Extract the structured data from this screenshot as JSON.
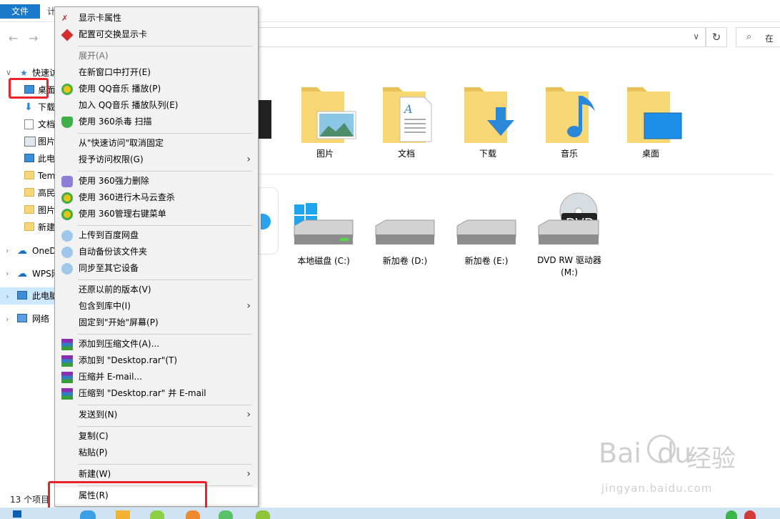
{
  "ribbon": {
    "file_tab": "文件",
    "tab2": "计"
  },
  "search": {
    "placeholder": "在"
  },
  "sidebar": {
    "items": [
      {
        "label": "快速访"
      },
      {
        "label": "桌面"
      },
      {
        "label": "下载"
      },
      {
        "label": "文档"
      },
      {
        "label": "图片"
      },
      {
        "label": "此电"
      },
      {
        "label": "Tem"
      },
      {
        "label": "高民"
      },
      {
        "label": "图片"
      },
      {
        "label": "新建"
      },
      {
        "label": "OneD"
      },
      {
        "label": "WPS网"
      },
      {
        "label": "此电脑"
      },
      {
        "label": "网络"
      }
    ]
  },
  "status": {
    "count": "13 个项目"
  },
  "folders": [
    {
      "label": "图片"
    },
    {
      "label": "文档"
    },
    {
      "label": "下载"
    },
    {
      "label": "音乐"
    },
    {
      "label": "桌面"
    }
  ],
  "drives": [
    {
      "label": "本地磁盘 (C:)"
    },
    {
      "label": "新加卷 (D:)"
    },
    {
      "label": "新加卷 (E:)"
    },
    {
      "label": "DVD RW 驱动器 (M:)",
      "badge": "DVD"
    }
  ],
  "menu": {
    "items": [
      {
        "label": "显示卡属性",
        "icon": "display-card-icon"
      },
      {
        "label": "配置可交换显示卡",
        "icon": "switchable-graphics-icon"
      },
      {
        "label": "展开(A)",
        "disabled": true
      },
      {
        "label": "在新窗口中打开(E)"
      },
      {
        "label": "使用 QQ音乐 播放(P)",
        "icon": "qq-music-icon"
      },
      {
        "label": "加入 QQ音乐 播放队列(E)"
      },
      {
        "label": "使用 360杀毒 扫描",
        "icon": "360-antivirus-icon"
      },
      {
        "label": "从\"快速访问\"取消固定"
      },
      {
        "label": "授予访问权限(G)",
        "submenu": true
      },
      {
        "label": "使用 360强力删除",
        "icon": "360-shred-icon"
      },
      {
        "label": "使用 360进行木马云查杀",
        "icon": "360-cloud-scan-icon"
      },
      {
        "label": "使用 360管理右键菜单",
        "icon": "360-menu-manager-icon"
      },
      {
        "label": "上传到百度网盘",
        "icon": "baidu-netdisk-icon"
      },
      {
        "label": "自动备份该文件夹",
        "icon": "baidu-netdisk-icon"
      },
      {
        "label": "同步至其它设备",
        "icon": "baidu-netdisk-icon"
      },
      {
        "label": "还原以前的版本(V)"
      },
      {
        "label": "包含到库中(I)",
        "submenu": true
      },
      {
        "label": "固定到\"开始\"屏幕(P)"
      },
      {
        "label": "添加到压缩文件(A)...",
        "icon": "winrar-icon"
      },
      {
        "label": "添加到 \"Desktop.rar\"(T)",
        "icon": "winrar-icon"
      },
      {
        "label": "压缩并 E-mail...",
        "icon": "winrar-icon"
      },
      {
        "label": "压缩到 \"Desktop.rar\" 并 E-mail",
        "icon": "winrar-icon"
      },
      {
        "label": "发送到(N)",
        "submenu": true
      },
      {
        "label": "复制(C)"
      },
      {
        "label": "粘贴(P)"
      },
      {
        "label": "新建(W)",
        "submenu": true
      },
      {
        "label": "属性(R)"
      }
    ]
  },
  "watermark": {
    "brand": "Bai",
    "brand2": "du",
    "cn": "经验",
    "url": "jingyan.baidu.com"
  },
  "colors": {
    "accent": "#1979ca",
    "highlight": "#e8232b",
    "selection": "#cce8ff"
  }
}
